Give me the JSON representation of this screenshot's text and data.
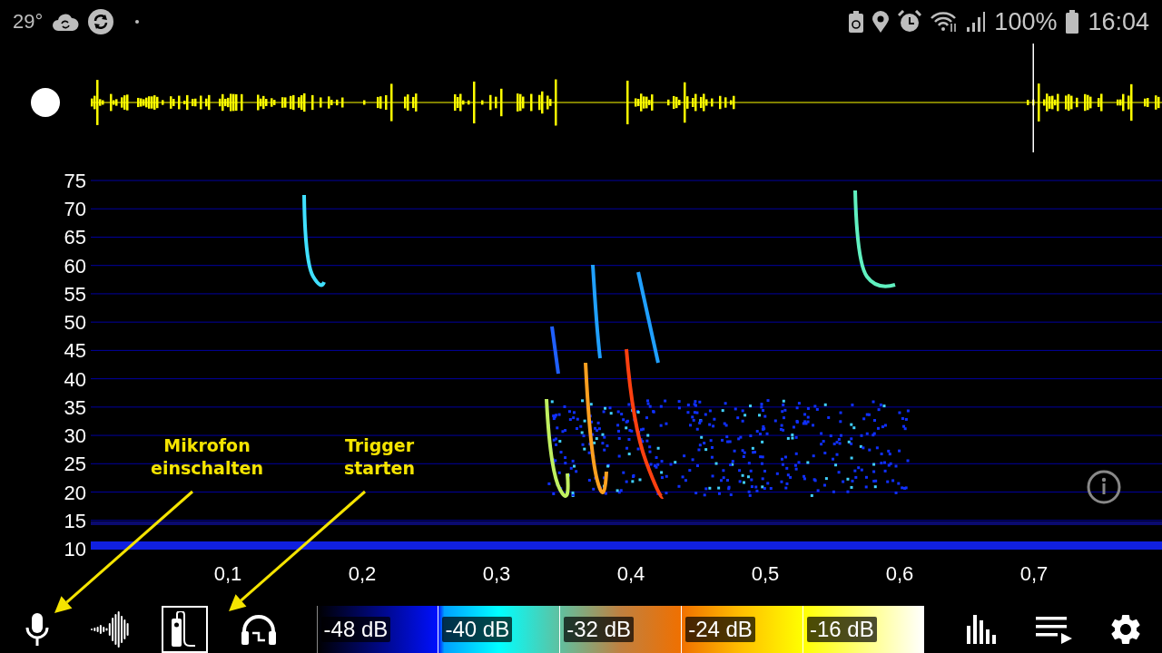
{
  "status_bar": {
    "temperature": "29°",
    "battery": "100%",
    "time": "16:04"
  },
  "spectrogram": {
    "y_labels": [
      "75",
      "70",
      "65",
      "60",
      "55",
      "50",
      "45",
      "40",
      "35",
      "30",
      "25",
      "20",
      "15",
      "10"
    ],
    "x_labels": [
      "0,1",
      "0,2",
      "0,3",
      "0,4",
      "0,5",
      "0,6",
      "0,7"
    ]
  },
  "annotations": [
    {
      "text": "Mikrofon\neinschalten"
    },
    {
      "text": "Trigger\nstarten"
    }
  ],
  "toolbar": {
    "left_tools": [
      {
        "kind": "microphone",
        "selected": false
      },
      {
        "kind": "waveform",
        "selected": false
      },
      {
        "kind": "trigger",
        "selected": true
      },
      {
        "kind": "headphones",
        "selected": false
      }
    ],
    "color_scale": [
      "-48 dB",
      "-40 dB",
      "-32 dB",
      "-24 dB",
      "-16 dB"
    ],
    "right_tools": [
      {
        "kind": "bar-chart"
      },
      {
        "kind": "playlist"
      },
      {
        "kind": "settings"
      }
    ]
  }
}
